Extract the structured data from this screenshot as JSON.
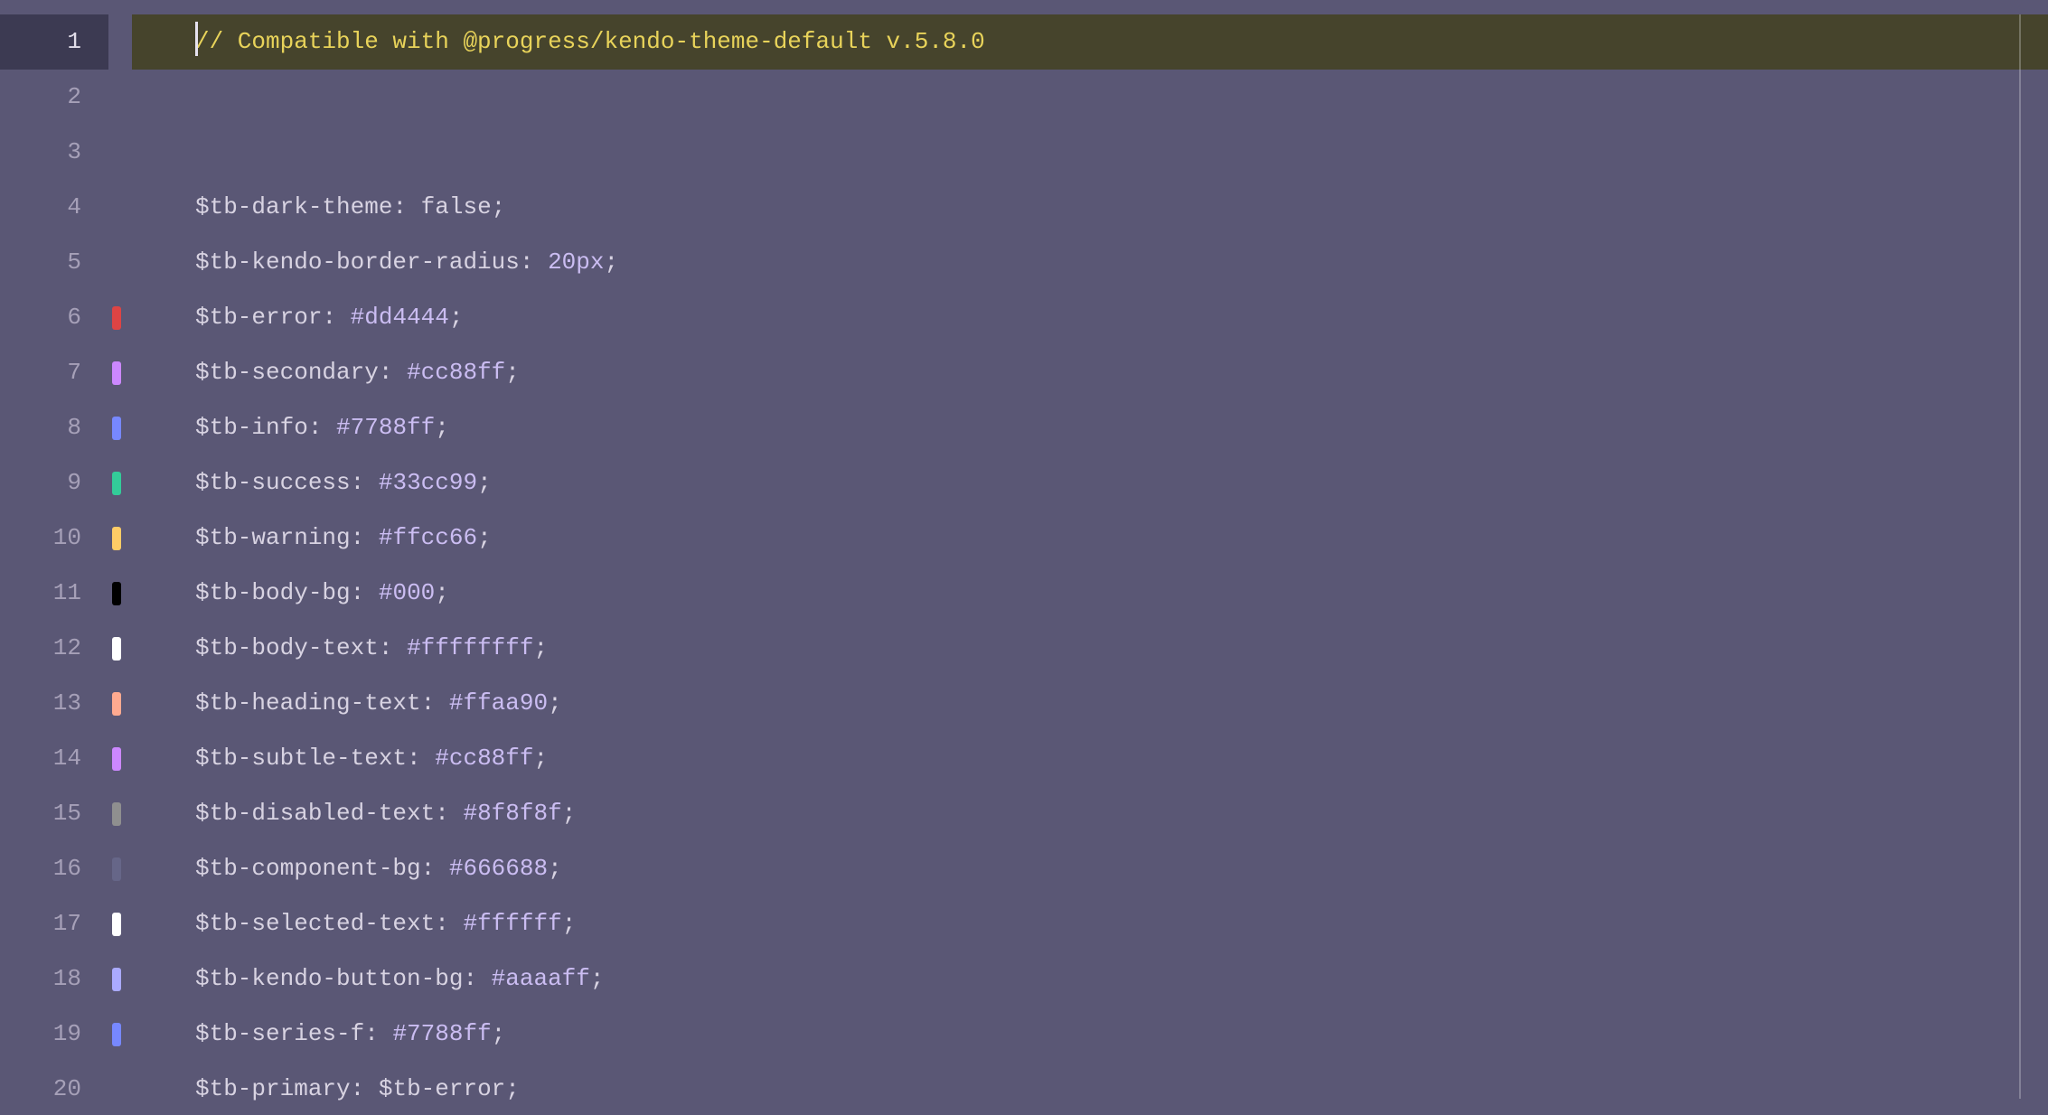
{
  "editor": {
    "active_line_index": 0,
    "lines": [
      {
        "num": "1",
        "swatch": null,
        "tokens": [
          {
            "cls": "cursor",
            "text": ""
          },
          {
            "cls": "t-comment",
            "text": "// Compatible with @progress/kendo-theme-default v.5.8.0"
          }
        ]
      },
      {
        "num": "2",
        "swatch": null,
        "tokens": []
      },
      {
        "num": "3",
        "swatch": null,
        "tokens": []
      },
      {
        "num": "4",
        "swatch": null,
        "tokens": [
          {
            "cls": "t-var",
            "text": "$tb-dark-theme"
          },
          {
            "cls": "t-punct",
            "text": ": "
          },
          {
            "cls": "t-key",
            "text": "false"
          },
          {
            "cls": "t-punct",
            "text": ";"
          }
        ]
      },
      {
        "num": "5",
        "swatch": null,
        "tokens": [
          {
            "cls": "t-var",
            "text": "$tb-kendo-border-radius"
          },
          {
            "cls": "t-punct",
            "text": ": "
          },
          {
            "cls": "t-num",
            "text": "20px"
          },
          {
            "cls": "t-punct",
            "text": ";"
          }
        ]
      },
      {
        "num": "6",
        "swatch": "#dd4444",
        "tokens": [
          {
            "cls": "t-var",
            "text": "$tb-error"
          },
          {
            "cls": "t-punct",
            "text": ": "
          },
          {
            "cls": "t-hex",
            "text": "#dd4444"
          },
          {
            "cls": "t-punct",
            "text": ";"
          }
        ]
      },
      {
        "num": "7",
        "swatch": "#cc88ff",
        "tokens": [
          {
            "cls": "t-var",
            "text": "$tb-secondary"
          },
          {
            "cls": "t-punct",
            "text": ": "
          },
          {
            "cls": "t-hex",
            "text": "#cc88ff"
          },
          {
            "cls": "t-punct",
            "text": ";"
          }
        ]
      },
      {
        "num": "8",
        "swatch": "#7788ff",
        "tokens": [
          {
            "cls": "t-var",
            "text": "$tb-info"
          },
          {
            "cls": "t-punct",
            "text": ": "
          },
          {
            "cls": "t-hex",
            "text": "#7788ff"
          },
          {
            "cls": "t-punct",
            "text": ";"
          }
        ]
      },
      {
        "num": "9",
        "swatch": "#33cc99",
        "tokens": [
          {
            "cls": "t-var",
            "text": "$tb-success"
          },
          {
            "cls": "t-punct",
            "text": ": "
          },
          {
            "cls": "t-hex",
            "text": "#33cc99"
          },
          {
            "cls": "t-punct",
            "text": ";"
          }
        ]
      },
      {
        "num": "10",
        "swatch": "#ffcc66",
        "tokens": [
          {
            "cls": "t-var",
            "text": "$tb-warning"
          },
          {
            "cls": "t-punct",
            "text": ": "
          },
          {
            "cls": "t-hex",
            "text": "#ffcc66"
          },
          {
            "cls": "t-punct",
            "text": ";"
          }
        ]
      },
      {
        "num": "11",
        "swatch": "#000000",
        "tokens": [
          {
            "cls": "t-var",
            "text": "$tb-body-bg"
          },
          {
            "cls": "t-punct",
            "text": ": "
          },
          {
            "cls": "t-hex",
            "text": "#000"
          },
          {
            "cls": "t-punct",
            "text": ";"
          }
        ]
      },
      {
        "num": "12",
        "swatch": "#ffffff",
        "tokens": [
          {
            "cls": "t-var",
            "text": "$tb-body-text"
          },
          {
            "cls": "t-punct",
            "text": ": "
          },
          {
            "cls": "t-hex",
            "text": "#ffffffff"
          },
          {
            "cls": "t-punct",
            "text": ";"
          }
        ]
      },
      {
        "num": "13",
        "swatch": "#ffaa90",
        "tokens": [
          {
            "cls": "t-var",
            "text": "$tb-heading-text"
          },
          {
            "cls": "t-punct",
            "text": ": "
          },
          {
            "cls": "t-hex",
            "text": "#ffaa90"
          },
          {
            "cls": "t-punct",
            "text": ";"
          }
        ]
      },
      {
        "num": "14",
        "swatch": "#cc88ff",
        "tokens": [
          {
            "cls": "t-var",
            "text": "$tb-subtle-text"
          },
          {
            "cls": "t-punct",
            "text": ": "
          },
          {
            "cls": "t-hex",
            "text": "#cc88ff"
          },
          {
            "cls": "t-punct",
            "text": ";"
          }
        ]
      },
      {
        "num": "15",
        "swatch": "#8f8f8f",
        "tokens": [
          {
            "cls": "t-var",
            "text": "$tb-disabled-text"
          },
          {
            "cls": "t-punct",
            "text": ": "
          },
          {
            "cls": "t-hex",
            "text": "#8f8f8f"
          },
          {
            "cls": "t-punct",
            "text": ";"
          }
        ]
      },
      {
        "num": "16",
        "swatch": "#666688",
        "tokens": [
          {
            "cls": "t-var",
            "text": "$tb-component-bg"
          },
          {
            "cls": "t-punct",
            "text": ": "
          },
          {
            "cls": "t-hex",
            "text": "#666688"
          },
          {
            "cls": "t-punct",
            "text": ";"
          }
        ]
      },
      {
        "num": "17",
        "swatch": "#ffffff",
        "tokens": [
          {
            "cls": "t-var",
            "text": "$tb-selected-text"
          },
          {
            "cls": "t-punct",
            "text": ": "
          },
          {
            "cls": "t-hex",
            "text": "#ffffff"
          },
          {
            "cls": "t-punct",
            "text": ";"
          }
        ]
      },
      {
        "num": "18",
        "swatch": "#aaaaff",
        "tokens": [
          {
            "cls": "t-var",
            "text": "$tb-kendo-button-bg"
          },
          {
            "cls": "t-punct",
            "text": ": "
          },
          {
            "cls": "t-hex",
            "text": "#aaaaff"
          },
          {
            "cls": "t-punct",
            "text": ";"
          }
        ]
      },
      {
        "num": "19",
        "swatch": "#7788ff",
        "tokens": [
          {
            "cls": "t-var",
            "text": "$tb-series-f"
          },
          {
            "cls": "t-punct",
            "text": ": "
          },
          {
            "cls": "t-hex",
            "text": "#7788ff"
          },
          {
            "cls": "t-punct",
            "text": ";"
          }
        ]
      },
      {
        "num": "20",
        "swatch": null,
        "tokens": [
          {
            "cls": "t-var",
            "text": "$tb-primary"
          },
          {
            "cls": "t-punct",
            "text": ": "
          },
          {
            "cls": "t-ident",
            "text": "$tb-error"
          },
          {
            "cls": "t-punct",
            "text": ";"
          }
        ]
      }
    ]
  }
}
